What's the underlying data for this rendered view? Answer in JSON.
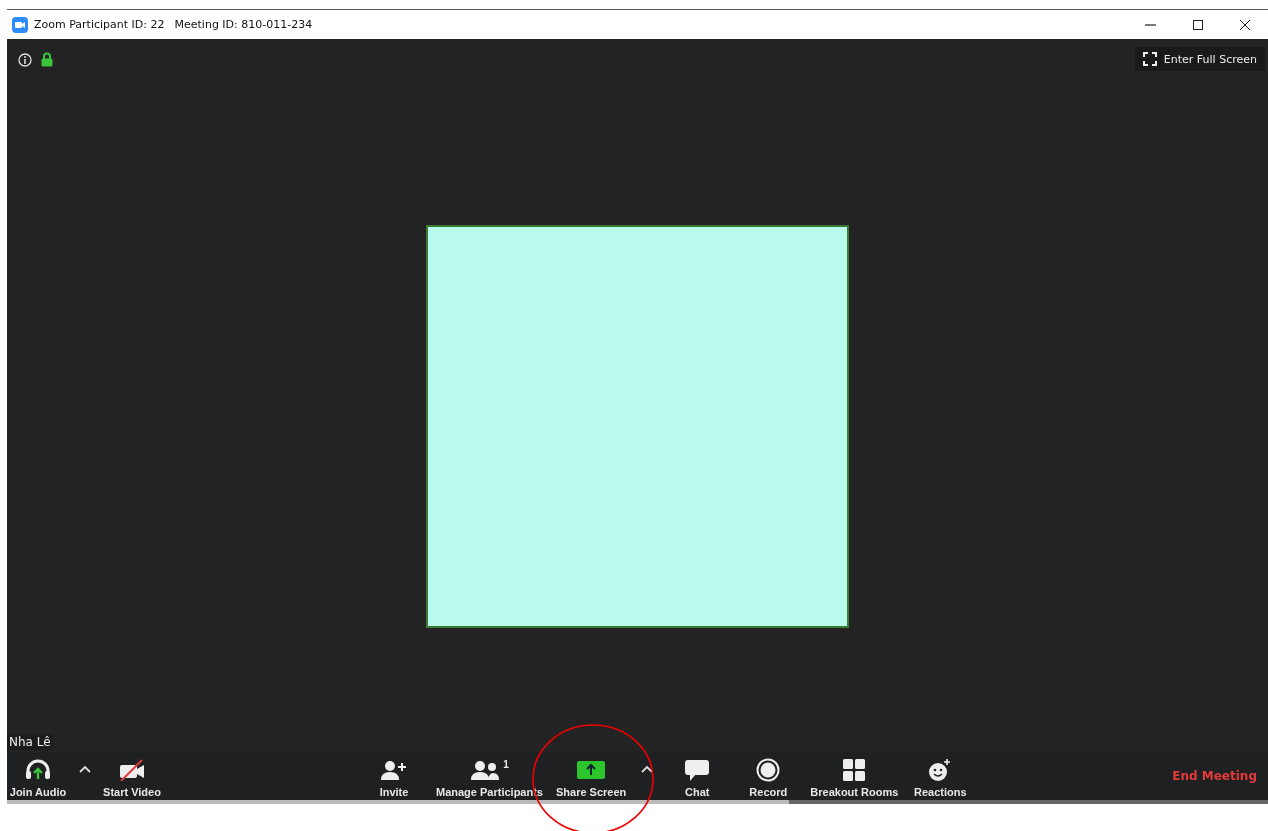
{
  "window": {
    "title": "Zoom Participant ID: 22",
    "subtitle": "Meeting ID: 810-011-234"
  },
  "top_bar": {
    "full_screen_button": "Enter Full Screen",
    "encrypted": true
  },
  "participant_name": "Nha Lê",
  "toolbar": {
    "left": [
      {
        "kind": "audio",
        "label": "Join Audio"
      },
      {
        "kind": "caret"
      },
      {
        "kind": "video",
        "label": "Start Video",
        "muted": true
      }
    ],
    "center": [
      {
        "kind": "invite",
        "label": "Invite"
      },
      {
        "kind": "participants",
        "label": "Manage Participants",
        "count": "1"
      },
      {
        "kind": "share",
        "label": "Share Screen"
      },
      {
        "kind": "caret"
      },
      {
        "kind": "chat",
        "label": "Chat"
      },
      {
        "kind": "record",
        "label": "Record"
      },
      {
        "kind": "breakout",
        "label": "Breakout Rooms"
      },
      {
        "kind": "reactions",
        "label": "Reactions"
      }
    ],
    "end_button": "End Meeting"
  }
}
